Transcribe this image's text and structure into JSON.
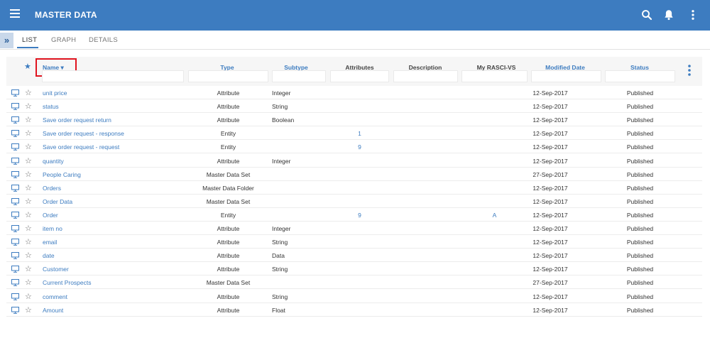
{
  "app": {
    "title": "MASTER DATA"
  },
  "tabs": [
    {
      "label": "LIST"
    },
    {
      "label": "GRAPH"
    },
    {
      "label": "DETAILS"
    }
  ],
  "columns": {
    "name": "Name",
    "type": "Type",
    "subtype": "Subtype",
    "attributes": "Attributes",
    "description": "Description",
    "rasci": "My RASCI-VS",
    "modified": "Modified Date",
    "status": "Status"
  },
  "colors": {
    "appbar": "#3d7cc0",
    "link": "#3d7cc0",
    "highlight": "#e0141f"
  },
  "rows": [
    {
      "name": "unit price",
      "type": "Attribute",
      "subtype": "Integer",
      "attributes": "",
      "rasci": "",
      "modified": "12-Sep-2017",
      "status": "Published"
    },
    {
      "name": "status",
      "type": "Attribute",
      "subtype": "String",
      "attributes": "",
      "rasci": "",
      "modified": "12-Sep-2017",
      "status": "Published"
    },
    {
      "name": "Save order request return",
      "type": "Attribute",
      "subtype": "Boolean",
      "attributes": "",
      "rasci": "",
      "modified": "12-Sep-2017",
      "status": "Published"
    },
    {
      "name": "Save order request - response",
      "type": "Entity",
      "subtype": "",
      "attributes": "1",
      "rasci": "",
      "modified": "12-Sep-2017",
      "status": "Published"
    },
    {
      "name": "Save order request - request",
      "type": "Entity",
      "subtype": "",
      "attributes": "9",
      "rasci": "",
      "modified": "12-Sep-2017",
      "status": "Published"
    },
    {
      "name": "quantity",
      "type": "Attribute",
      "subtype": "Integer",
      "attributes": "",
      "rasci": "",
      "modified": "12-Sep-2017",
      "status": "Published"
    },
    {
      "name": "People Caring",
      "type": "Master Data Set",
      "subtype": "",
      "attributes": "",
      "rasci": "",
      "modified": "27-Sep-2017",
      "status": "Published"
    },
    {
      "name": "Orders",
      "type": "Master Data Folder",
      "subtype": "",
      "attributes": "",
      "rasci": "",
      "modified": "12-Sep-2017",
      "status": "Published"
    },
    {
      "name": "Order Data",
      "type": "Master Data Set",
      "subtype": "",
      "attributes": "",
      "rasci": "",
      "modified": "12-Sep-2017",
      "status": "Published"
    },
    {
      "name": "Order",
      "type": "Entity",
      "subtype": "",
      "attributes": "9",
      "rasci": "A",
      "modified": "12-Sep-2017",
      "status": "Published"
    },
    {
      "name": "item no",
      "type": "Attribute",
      "subtype": "Integer",
      "attributes": "",
      "rasci": "",
      "modified": "12-Sep-2017",
      "status": "Published"
    },
    {
      "name": "email",
      "type": "Attribute",
      "subtype": "String",
      "attributes": "",
      "rasci": "",
      "modified": "12-Sep-2017",
      "status": "Published"
    },
    {
      "name": "date",
      "type": "Attribute",
      "subtype": "Data",
      "attributes": "",
      "rasci": "",
      "modified": "12-Sep-2017",
      "status": "Published"
    },
    {
      "name": "Customer",
      "type": "Attribute",
      "subtype": "String",
      "attributes": "",
      "rasci": "",
      "modified": "12-Sep-2017",
      "status": "Published"
    },
    {
      "name": "Current Prospects",
      "type": "Master Data Set",
      "subtype": "",
      "attributes": "",
      "rasci": "",
      "modified": "27-Sep-2017",
      "status": "Published"
    },
    {
      "name": "comment",
      "type": "Attribute",
      "subtype": "String",
      "attributes": "",
      "rasci": "",
      "modified": "12-Sep-2017",
      "status": "Published"
    },
    {
      "name": "Amount",
      "type": "Attribute",
      "subtype": "Float",
      "attributes": "",
      "rasci": "",
      "modified": "12-Sep-2017",
      "status": "Published"
    }
  ]
}
